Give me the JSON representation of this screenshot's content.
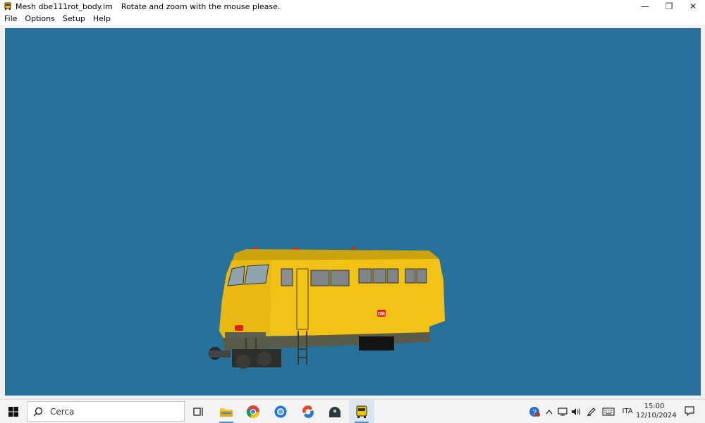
{
  "window": {
    "title": "Mesh dbe111rot_body.im",
    "hint": "Rotate and zoom with the mouse please."
  },
  "controls": {
    "minimize": "—",
    "maximize": "❐",
    "close": "✕"
  },
  "menu": {
    "items": [
      "File",
      "Options",
      "Setup",
      "Help"
    ]
  },
  "viewport": {
    "background": "#27729a",
    "model": {
      "db_logo": "DB",
      "body_color": "#f5c518"
    }
  },
  "taskbar": {
    "search_placeholder": "Cerca",
    "language": "ITA",
    "time": "15:00",
    "date": "12/10/2024"
  }
}
